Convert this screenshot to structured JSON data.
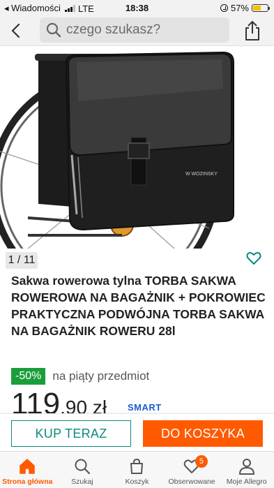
{
  "status_bar": {
    "carrier_back": "◂ Wiadomości",
    "network": "LTE",
    "time": "18:38",
    "battery": "57%",
    "battery_level": 0.57
  },
  "header": {
    "search_placeholder": "czego szukasz?"
  },
  "product": {
    "image_counter": "1 / 11",
    "image_brand_text": "WOZINSKY",
    "title": "Sakwa rowerowa tylna TORBA SAKWA ROWEROWA NA BAGAŻNIK + POKROWIEC PRAKTYCZNA PODWÓJNA TORBA SAKWA NA BAGAŻNIK ROWERU 28l",
    "discount": "-50%",
    "promo_text": "na piąty przedmiot",
    "price_main": "119",
    "price_rest": ",90 zł",
    "smart_label": "SMART"
  },
  "actions": {
    "buy_now": "KUP TERAZ",
    "add_to_cart": "DO KOSZYKA"
  },
  "tabs": [
    {
      "label": "Strona główna",
      "icon": "home-icon",
      "active": true
    },
    {
      "label": "Szukaj",
      "icon": "search-icon"
    },
    {
      "label": "Koszyk",
      "icon": "cart-icon"
    },
    {
      "label": "Obserwowane",
      "icon": "heart-icon",
      "badge": "5"
    },
    {
      "label": "Moje Allegro",
      "icon": "user-icon"
    }
  ],
  "colors": {
    "accent": "#ff5a00",
    "teal": "#0a8a7e",
    "discount": "#1a9e3a"
  }
}
